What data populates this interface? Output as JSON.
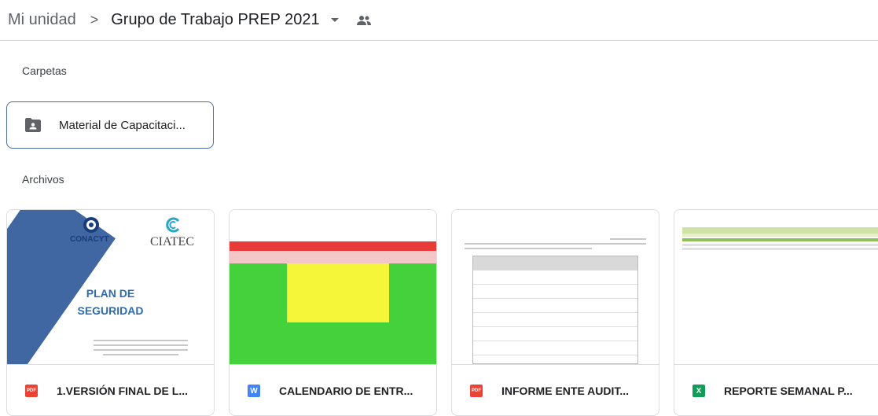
{
  "breadcrumb": {
    "root": "Mi unidad",
    "separator": ">",
    "current": "Grupo de Trabajo PREP 2021"
  },
  "sections": {
    "folders_label": "Carpetas",
    "files_label": "Archivos"
  },
  "folders": [
    {
      "name": "Material de Capacitaci...",
      "icon": "shared-folder-icon"
    }
  ],
  "files": [
    {
      "name": "1.VERSIÓN FINAL DE L...",
      "type": "pdf",
      "icon_text": "PDF",
      "thumbnail": {
        "org1": "CONACYT",
        "org2": "CIATEC",
        "title_line1": "PLAN DE",
        "title_line2": "SEGURIDAD"
      }
    },
    {
      "name": "CALENDARIO DE ENTR...",
      "type": "word",
      "icon_text": "W"
    },
    {
      "name": "INFORME ENTE AUDIT...",
      "type": "pdf",
      "icon_text": "PDF"
    },
    {
      "name": "REPORTE SEMANAL P...",
      "type": "excel",
      "icon_text": "X"
    }
  ],
  "colors": {
    "pdf": "#ea4335",
    "word": "#4285f4",
    "excel": "#0f9d58",
    "folder_border": "#4a6fa5"
  }
}
